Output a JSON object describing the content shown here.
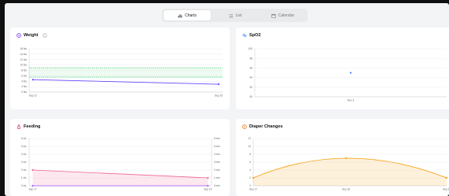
{
  "tabs": [
    {
      "label": "Charts",
      "icon": "bar-chart-icon",
      "active": true
    },
    {
      "label": "List",
      "icon": "list-icon",
      "active": false
    },
    {
      "label": "Calendar",
      "icon": "calendar-icon",
      "active": false
    }
  ],
  "cards": {
    "weight": {
      "title": "Weight",
      "icon": "weight-icon",
      "info_icon": "info-icon"
    },
    "spo2": {
      "title": "SpO2",
      "icon": "pulse-icon"
    },
    "feeding": {
      "title": "Feeding",
      "icon": "bottle-icon"
    },
    "diaper": {
      "title": "Diaper Changes",
      "icon": "diaper-icon"
    }
  },
  "chart_data": [
    {
      "type": "line",
      "title": "Weight",
      "x": [
        "Sep 12",
        "Sep 23"
      ],
      "series": [
        {
          "values": [
            4.6,
            2.9
          ],
          "color": "#6b46ff"
        }
      ],
      "ylim": [
        0,
        16
      ],
      "yticks": [
        "0 lbs",
        "2 lbs",
        "4 lbs",
        "6 lbs",
        "8 lbs",
        "10 lbs",
        "12 lbs",
        "14 lbs",
        "16 lbs"
      ],
      "band": {
        "from": 5.5,
        "to": 9.0,
        "color": "#22c55e"
      },
      "grid": true
    },
    {
      "type": "scatter",
      "title": "SpO2",
      "x": [
        "Nov 3"
      ],
      "series": [
        {
          "values": [
            95
          ],
          "color": "#3b82f6"
        }
      ],
      "ylim": [
        90,
        100
      ],
      "yticks": [
        "90",
        "92",
        "94",
        "96",
        "98",
        "100"
      ],
      "grid": true
    },
    {
      "type": "area",
      "title": "Feeding",
      "x": [
        "Sep 17",
        "Sep 19"
      ],
      "series": [
        {
          "values": [
            2,
            1
          ],
          "color": "#f06292"
        },
        {
          "values": [
            0,
            0
          ],
          "color": "#a855f7"
        }
      ],
      "ylim": [
        0,
        6
      ],
      "yticks": [
        "0 mL",
        "1 mL",
        "2 mL",
        "3 mL",
        "4 mL",
        "5 mL",
        "6 mL"
      ],
      "yticks_right": [
        "0 min",
        "1 min",
        "2 min",
        "3 min",
        "4 min",
        "5 min",
        "6 min"
      ],
      "grid": true
    },
    {
      "type": "area",
      "title": "Diaper Changes",
      "x": [
        "Sep 17",
        "Sep 18",
        "Sep 22"
      ],
      "series": [
        {
          "values": [
            2,
            7,
            2
          ],
          "color": "#f59e0b"
        }
      ],
      "ylim": [
        0,
        12
      ],
      "yticks": [
        "0",
        "2",
        "4",
        "6",
        "8",
        "10",
        "12"
      ],
      "grid": true
    }
  ]
}
